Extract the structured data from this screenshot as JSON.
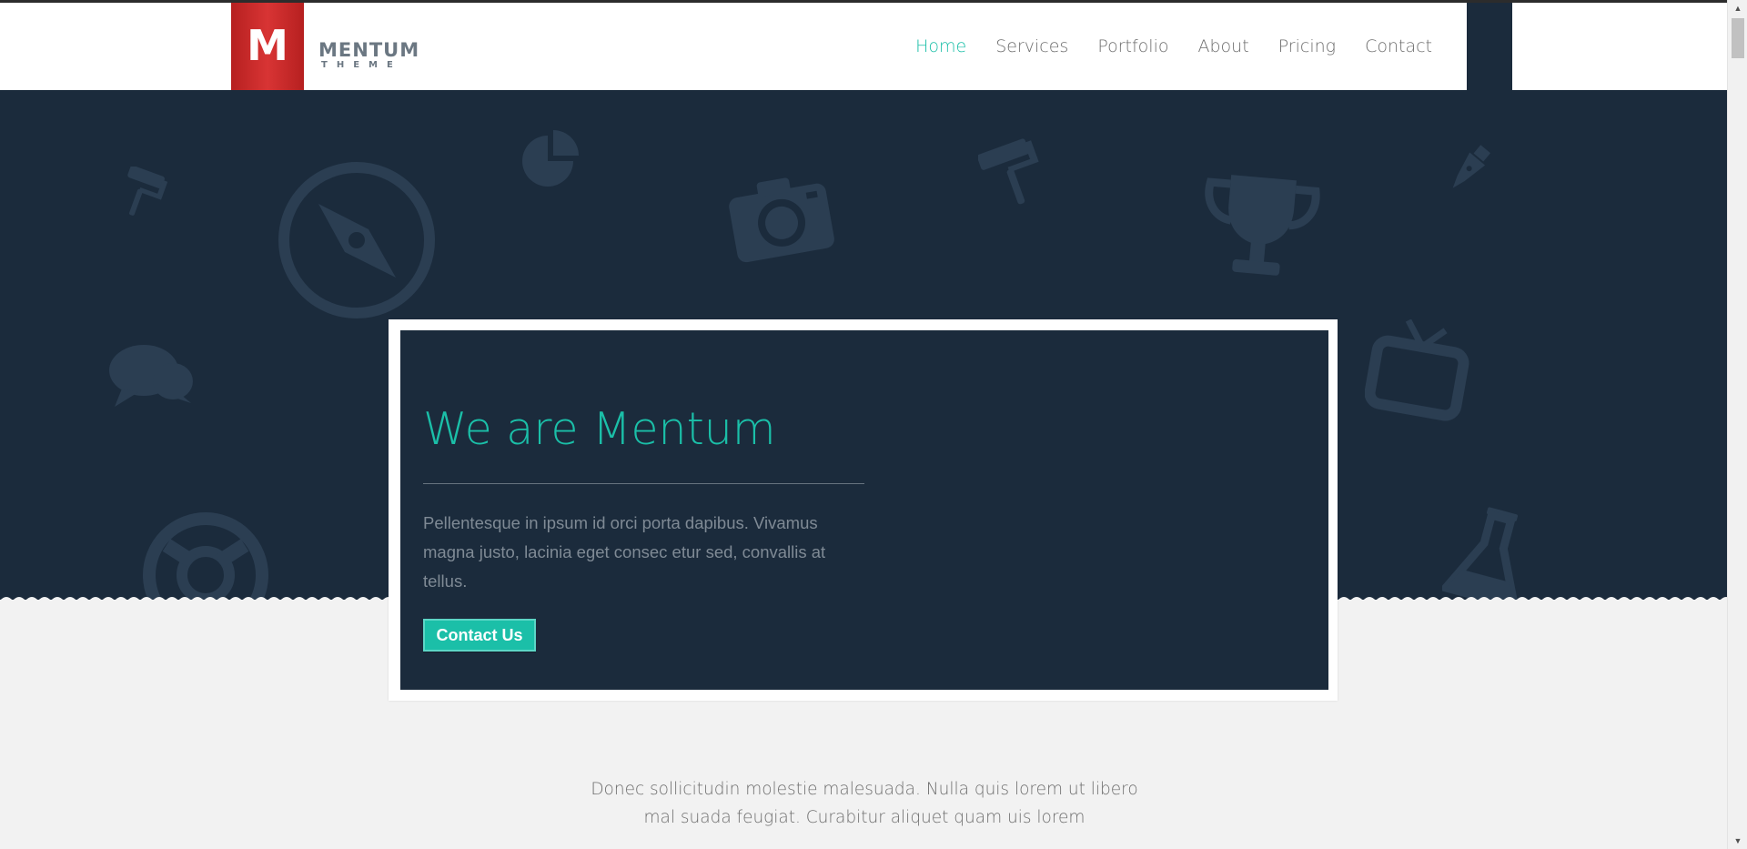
{
  "brand": {
    "letter": "M",
    "name": "MENTUM",
    "tagline": "THEME",
    "ribbon_color": "#d02b2b"
  },
  "nav": {
    "items": [
      {
        "label": "Home",
        "active": true
      },
      {
        "label": "Services",
        "active": false
      },
      {
        "label": "Portfolio",
        "active": false
      },
      {
        "label": "About",
        "active": false
      },
      {
        "label": "Pricing",
        "active": false
      },
      {
        "label": "Contact",
        "active": false
      }
    ]
  },
  "hero": {
    "background_color": "#1b2b3c",
    "icons": [
      "paint-roller-icon",
      "compass-icon",
      "pie-chart-icon",
      "camera-icon",
      "paint-roller-icon",
      "trophy-icon",
      "pen-nib-icon",
      "chat-bubbles-icon",
      "tv-icon",
      "lifebuoy-icon",
      "flask-icon"
    ],
    "card": {
      "title": "We are Mentum",
      "text": "Pellentesque in ipsum id orci porta dapibus. Vivamus magna justo, lacinia eget consec etur sed, convallis at tellus.",
      "button_label": "Contact Us"
    }
  },
  "intro": {
    "text": "Donec sollicitudin molestie malesuada. Nulla quis lorem ut libero mal suada feugiat. Curabitur aliquet quam uis lorem"
  },
  "colors": {
    "accent": "#1bbfa8",
    "dark": "#1b2b3c",
    "page_bg": "#f2f2f2"
  },
  "scrollbar": {
    "up_icon": "scroll-up-arrow-icon",
    "down_icon": "scroll-down-arrow-icon"
  }
}
